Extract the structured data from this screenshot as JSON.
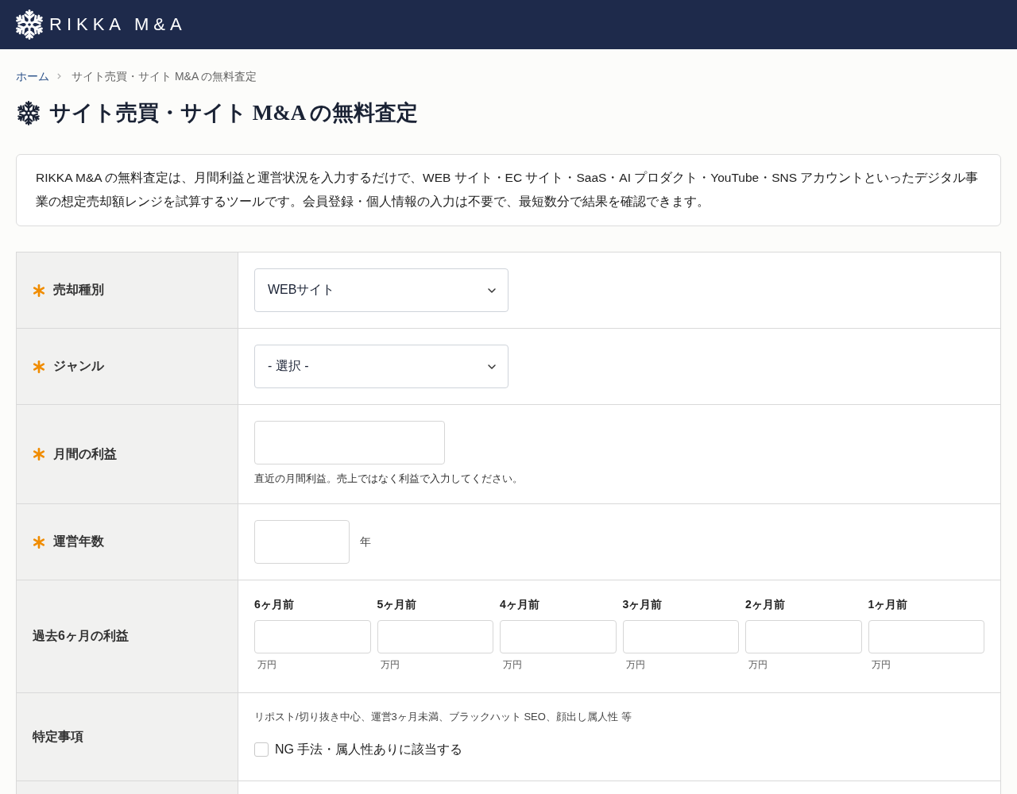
{
  "header": {
    "logo_text": "RIKKA M&A"
  },
  "breadcrumb": [
    {
      "label": "ホーム",
      "kind": "link"
    },
    {
      "label": "サイト売買・サイト M&A の無料査定",
      "kind": "current"
    }
  ],
  "page_title": "サイト売買・サイト M&A の無料査定",
  "intro": "RIKKA M&A の無料査定は、月間利益と運営状況を入力するだけで、WEB サイト・EC サイト・SaaS・AI プロダクト・YouTube・SNS アカウントといったデジタル事業の想定売却額レンジを試算するツールです。会員登録・個人情報の入力は不要で、最短数分で結果を確認できます。",
  "form_rows": [
    {
      "label": "売却種別",
      "required": true,
      "kind": "select",
      "value": "WEBサイト"
    },
    {
      "label": "ジャンル",
      "required": true,
      "kind": "select",
      "value": "- 選択 -"
    },
    {
      "label": "月間の利益",
      "required": true,
      "kind": "text",
      "help": "直近の月間利益。売上ではなく利益で入力してください。"
    },
    {
      "label": "運営年数",
      "required": true,
      "kind": "number",
      "suffix": "年"
    },
    {
      "label": "過去6ヶ月の利益",
      "required": false,
      "kind": "months",
      "months": [
        {
          "label": "6ヶ月前",
          "unit": "万円"
        },
        {
          "label": "5ヶ月前",
          "unit": "万円"
        },
        {
          "label": "4ヶ月前",
          "unit": "万円"
        },
        {
          "label": "3ヶ月前",
          "unit": "万円"
        },
        {
          "label": "2ヶ月前",
          "unit": "万円"
        },
        {
          "label": "1ヶ月前",
          "unit": "万円"
        }
      ]
    },
    {
      "label": "特定事項",
      "required": false,
      "kind": "checkbox",
      "note": "リポスト/切り抜き中心、運営3ヶ月未満、ブラックハット SEO、顔出し属人性 等",
      "option": {
        "label": "NG 手法・属人性ありに該当する",
        "checked": false
      }
    }
  ]
}
